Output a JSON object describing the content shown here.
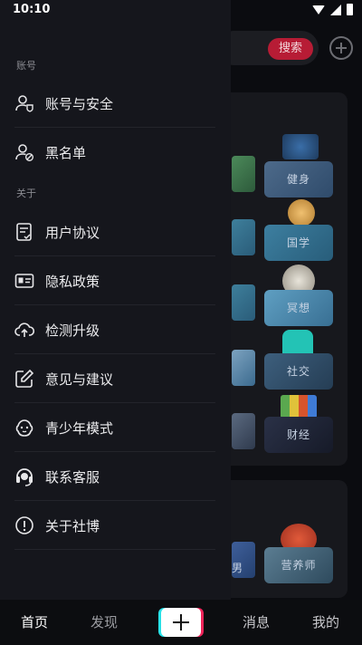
{
  "status_bar": {
    "time": "10:10"
  },
  "background": {
    "search_label": "搜索",
    "tiles": [
      "健身",
      "国学",
      "冥想",
      "社交",
      "财经",
      "营养师"
    ],
    "partial_label": "男"
  },
  "drawer": {
    "section_account": "账号",
    "section_about": "关于",
    "items": [
      {
        "label": "账号与安全",
        "icon": "user-shield-icon"
      },
      {
        "label": "黑名单",
        "icon": "user-block-icon"
      },
      {
        "label": "用户协议",
        "icon": "document-check-icon"
      },
      {
        "label": "隐私政策",
        "icon": "id-card-icon"
      },
      {
        "label": "检测升级",
        "icon": "cloud-upload-icon"
      },
      {
        "label": "意见与建议",
        "icon": "edit-icon"
      },
      {
        "label": "青少年模式",
        "icon": "kid-face-icon"
      },
      {
        "label": "联系客服",
        "icon": "headset-icon"
      },
      {
        "label": "关于社博",
        "icon": "info-icon"
      }
    ]
  },
  "tabbar": {
    "home": "首页",
    "discover": "发现",
    "messages": "消息",
    "me": "我的"
  },
  "colors": {
    "accent_red": "#b71c35",
    "create_cyan": "#27e2e8",
    "create_pink": "#f0245a"
  }
}
